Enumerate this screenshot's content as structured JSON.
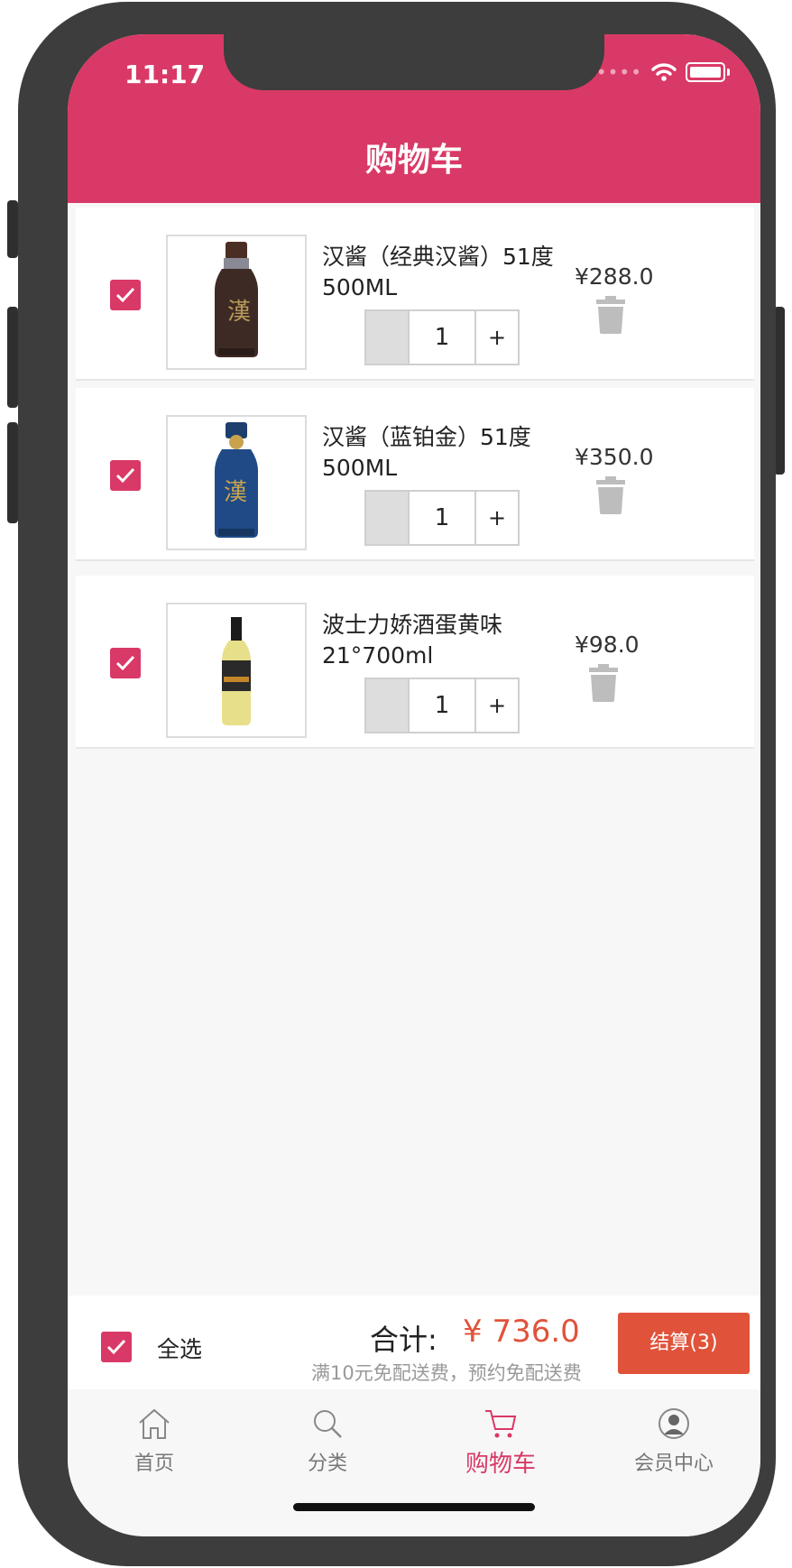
{
  "status_bar": {
    "time": "11:17",
    "signal": "••••"
  },
  "header": {
    "title": "购物车"
  },
  "cart_items": [
    {
      "name": "汉酱（经典汉酱）51度500ML",
      "quantity": "1",
      "plus": "+",
      "price": "¥288.0",
      "checked": true
    },
    {
      "name": "汉酱（蓝铂金）51度500ML",
      "quantity": "1",
      "plus": "+",
      "price": "¥350.0",
      "checked": true
    },
    {
      "name": "波士力娇酒蛋黄味21°700ml",
      "quantity": "1",
      "plus": "+",
      "price": "¥98.0",
      "checked": true
    }
  ],
  "footer": {
    "select_all": "全选",
    "total_label": "合计:",
    "total_value": "¥ 736.0",
    "shipping_note": "满10元免配送费，预约免配送费",
    "checkout_label": "结算(3)"
  },
  "tabs": [
    {
      "label": "首页",
      "icon": "home-icon"
    },
    {
      "label": "分类",
      "icon": "search-icon"
    },
    {
      "label": "购物车",
      "icon": "cart-icon",
      "active": true
    },
    {
      "label": "会员中心",
      "icon": "user-icon"
    }
  ],
  "colors": {
    "brand": "#d93966",
    "price": "#e0533a"
  }
}
